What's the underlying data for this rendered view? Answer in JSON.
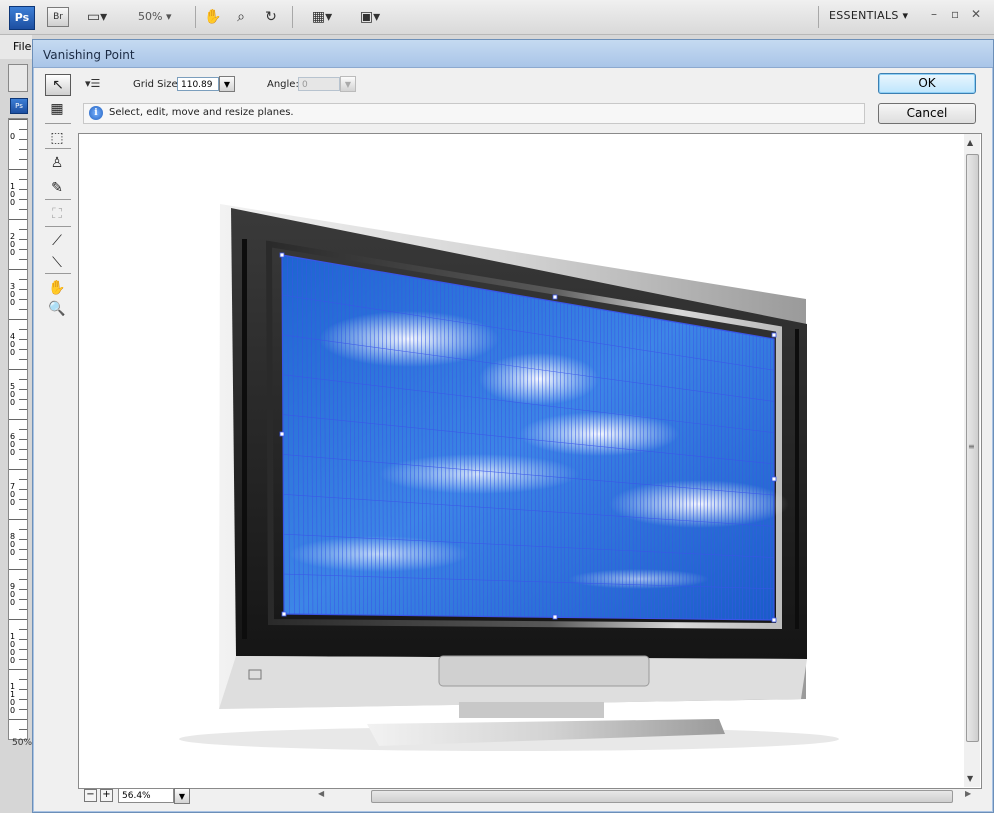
{
  "app": {
    "logo": "Ps",
    "bridge": "Br",
    "zoom": "50%",
    "workspace": "ESSENTIALS",
    "menu_first": "File"
  },
  "dialog": {
    "title": "Vanishing Point",
    "grid_size_label": "Grid Size:",
    "grid_size_value": "110.89",
    "angle_label": "Angle:",
    "angle_value": "0",
    "info_text": "Select, edit, move and resize planes.",
    "ok_label": "OK",
    "cancel_label": "Cancel",
    "zoom_value": "56.4%"
  },
  "tools": [
    {
      "name": "edit-plane-tool-icon",
      "glyph": "↖"
    },
    {
      "name": "create-plane-tool-icon",
      "glyph": "▦"
    },
    {
      "name": "marquee-tool-icon",
      "glyph": "⬚"
    },
    {
      "name": "stamp-tool-icon",
      "glyph": "♙"
    },
    {
      "name": "brush-tool-icon",
      "glyph": "✎"
    },
    {
      "name": "transform-tool-icon",
      "glyph": "⛶"
    },
    {
      "name": "eyedropper-tool-icon",
      "glyph": "⟋"
    },
    {
      "name": "measure-tool-icon",
      "glyph": "⟍"
    },
    {
      "name": "hand-tool-icon",
      "glyph": "✋"
    },
    {
      "name": "zoom-tool-icon",
      "glyph": "🔍"
    }
  ],
  "status": {
    "doc_zoom": "50%"
  },
  "ruler_numbers": [
    "0",
    "100",
    "200",
    "300",
    "400",
    "500",
    "600",
    "700",
    "800",
    "900",
    "1000",
    "1100"
  ],
  "colors": {
    "screen_blue": "#1f6fd6",
    "grid_line": "#2f55e0",
    "ok_accent": "#3c7fb1"
  }
}
